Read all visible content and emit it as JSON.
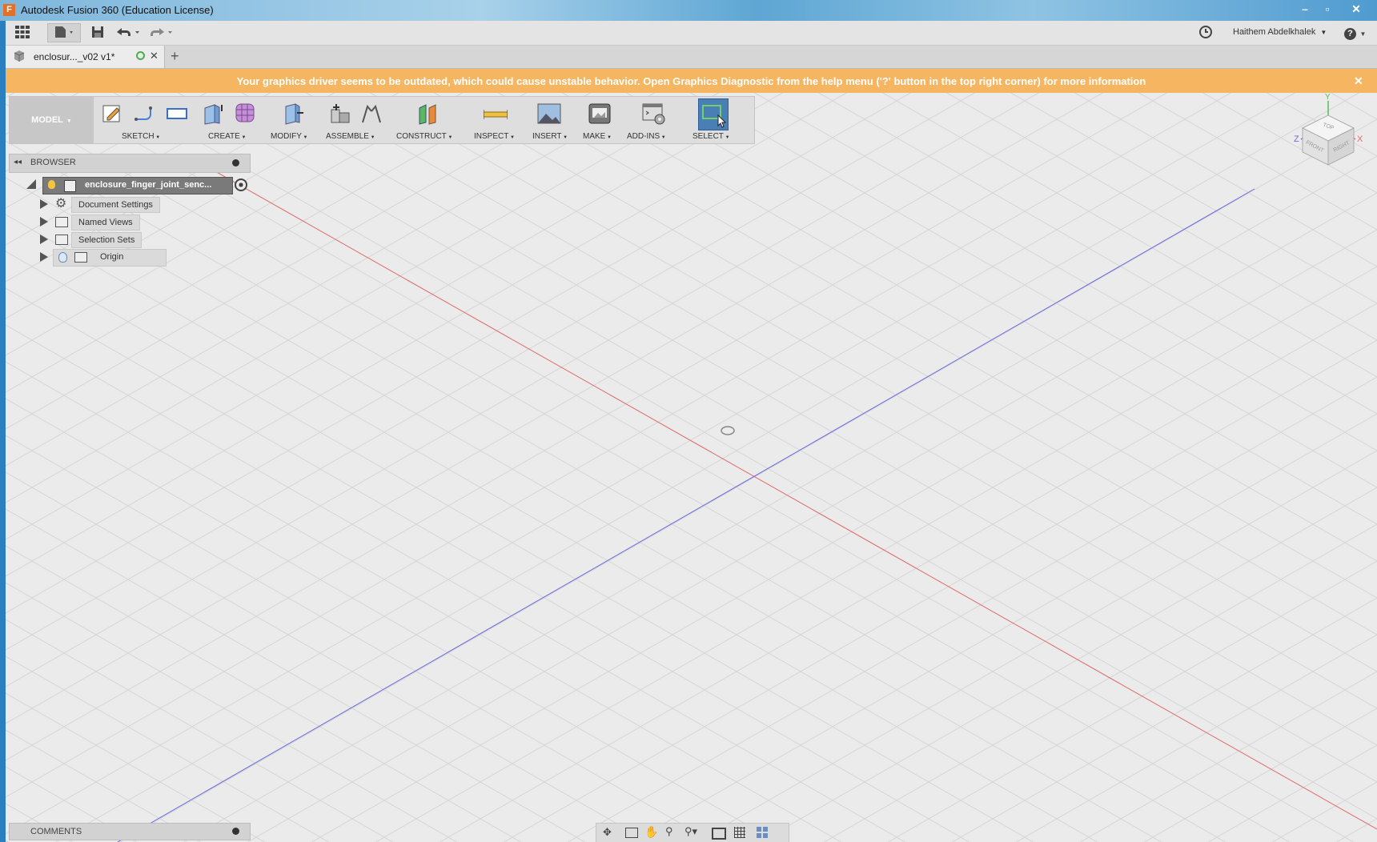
{
  "window": {
    "title": "Autodesk Fusion 360 (Education License)",
    "app_logo_letter": "F",
    "minimize": "–",
    "maximize": "▫",
    "close": "✕"
  },
  "topbar": {
    "user_name": "Haithem Abdelkhalek",
    "help_label": "?"
  },
  "tabs": [
    {
      "label": "enclosur..._v02 v1*"
    }
  ],
  "tab_add": "+",
  "banner": {
    "message": "Your graphics driver seems to be outdated, which could cause unstable behavior. Open Graphics Diagnostic from the help menu ('?' button in the top right corner) for more information",
    "close": "✕"
  },
  "toolbar": {
    "workspace": "MODEL",
    "groups": [
      "SKETCH",
      "CREATE",
      "MODIFY",
      "ASSEMBLE",
      "CONSTRUCT",
      "INSPECT",
      "INSERT",
      "MAKE",
      "ADD-INS",
      "SELECT"
    ]
  },
  "browser": {
    "title": "BROWSER",
    "root": "enclosure_finger_joint_senc...",
    "nodes": [
      {
        "label": "Document Settings"
      },
      {
        "label": "Named Views"
      },
      {
        "label": "Selection Sets"
      },
      {
        "label": "Origin"
      }
    ]
  },
  "comments": {
    "title": "COMMENTS"
  },
  "viewcube": {
    "top": "TOP",
    "front": "FRONT",
    "right": "RIGHT",
    "axis_x": "X",
    "axis_y": "Y",
    "axis_z": "Z"
  },
  "colors": {
    "banner": "#f6b560",
    "x_axis": "#e06a6a",
    "z_axis": "#6a6ae0",
    "select_active": "#4a7fb5"
  }
}
